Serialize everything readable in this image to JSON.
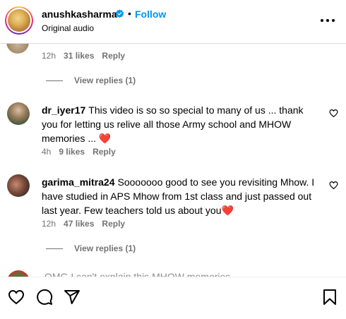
{
  "post": {
    "username": "anushkasharma",
    "separator": "•",
    "follow_label": "Follow",
    "subtitle": "Original audio"
  },
  "previous_comment": {
    "time": "12h",
    "likes": "31 likes",
    "reply": "Reply",
    "view_replies": "View replies (1)"
  },
  "comments": [
    {
      "username": "dr_iyer17",
      "text": "This video is so so special to many of us ... thank you for letting us relive all those Army school and MHOW memories ... ❤️",
      "time": "4h",
      "likes": "9 likes",
      "reply": "Reply"
    },
    {
      "username": "garima_mitra24",
      "text": "Sooooooo good to see you revisiting Mhow. I have studied in APS Mhow from 1st class and just passed out last year. Few teachers told us about you❤️",
      "time": "12h",
      "likes": "47 likes",
      "reply": "Reply",
      "view_replies": "View replies (1)"
    }
  ],
  "partial_comment": {
    "username": "",
    "text": "OMG I can't explain this MHOW memories"
  },
  "colors": {
    "accent": "#0095f6",
    "secondary_text": "#737373",
    "heart": "#ed4956",
    "verified": "#0095f6"
  },
  "icons": {
    "more": "more-horizontal-icon",
    "like": "heart-icon",
    "comment": "comment-icon",
    "share": "share-icon",
    "save": "bookmark-icon"
  }
}
